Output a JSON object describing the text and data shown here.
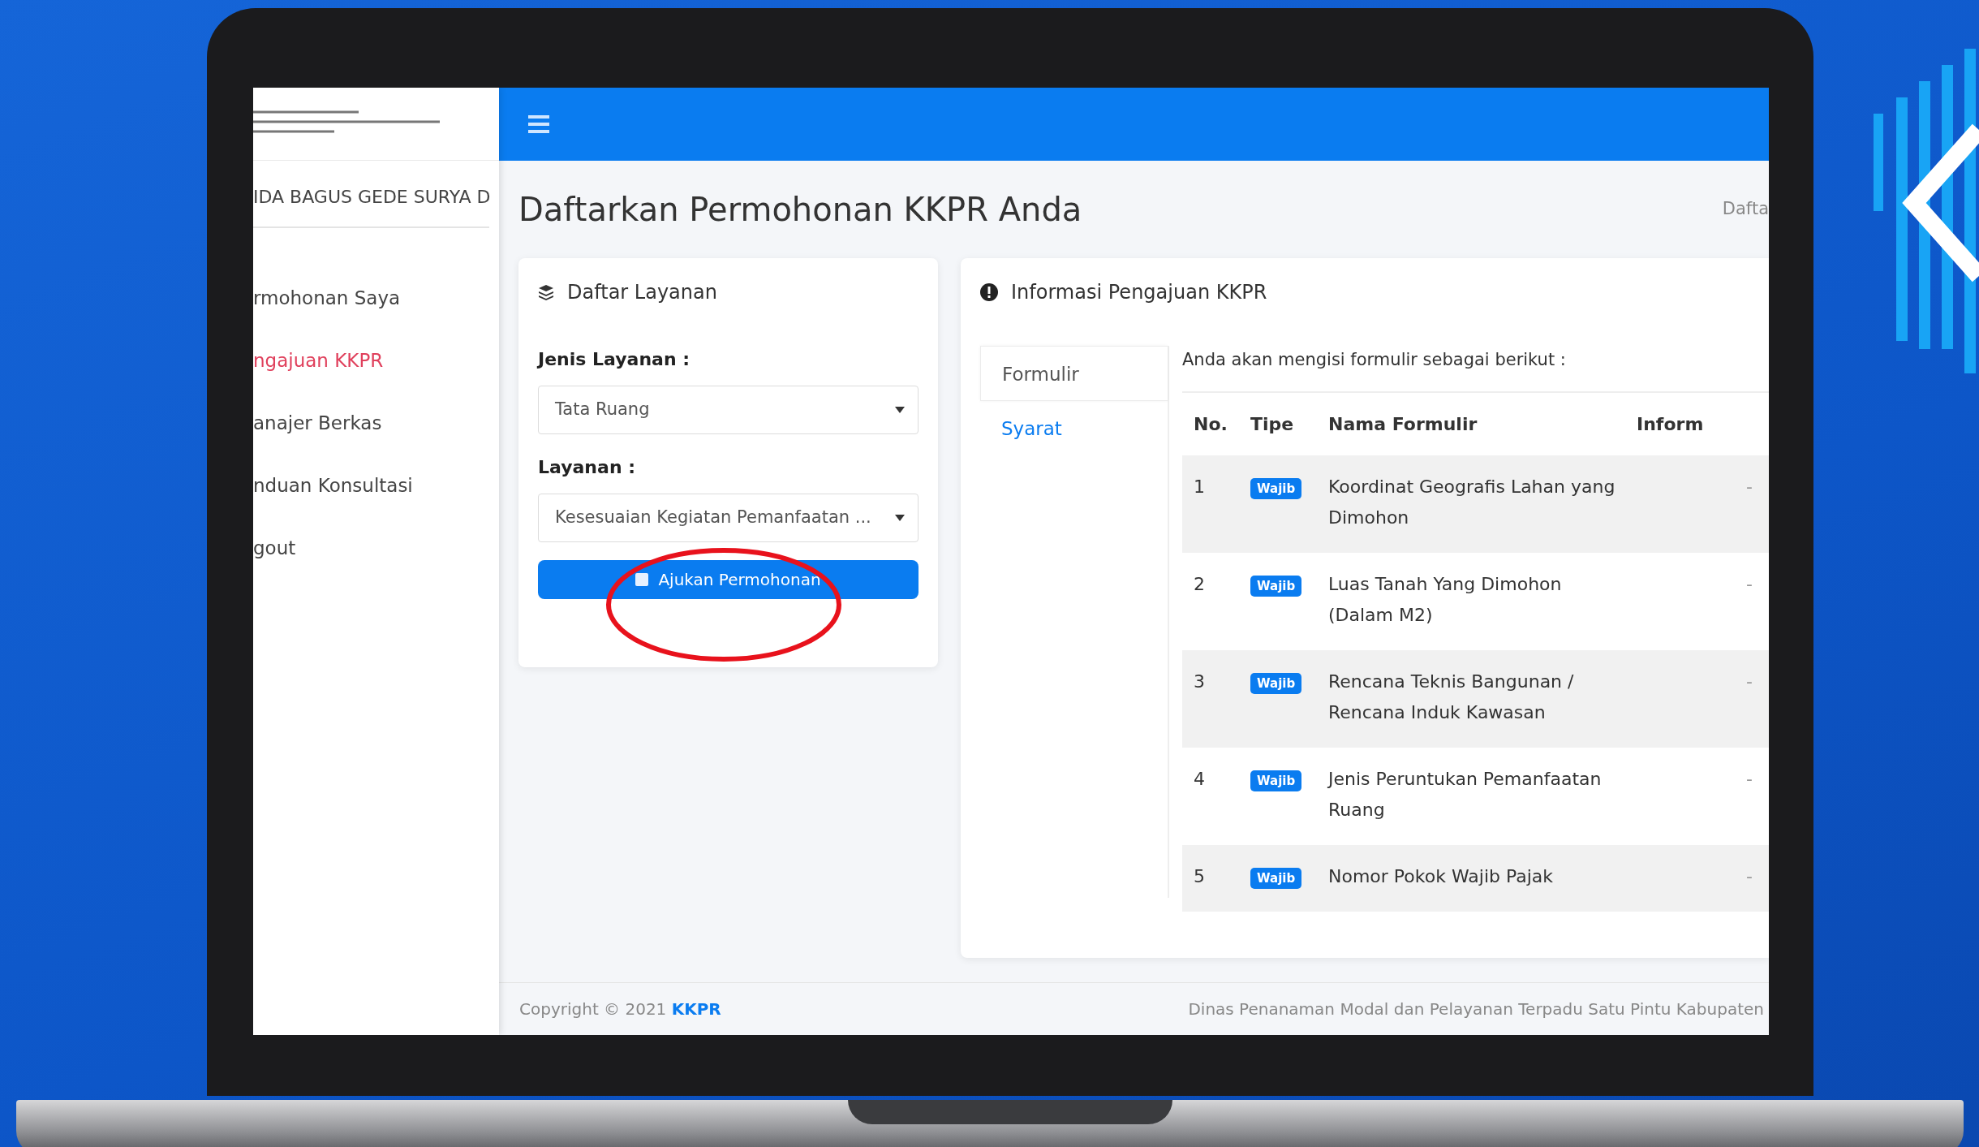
{
  "sidebar": {
    "user_name": "IDA BAGUS GEDE SURYA D",
    "items": [
      {
        "label": "rmohonan Saya",
        "selected": false
      },
      {
        "label": "ngajuan KKPR",
        "selected": true
      },
      {
        "label": "anajer Berkas",
        "selected": false
      },
      {
        "label": "nduan Konsultasi",
        "selected": false
      },
      {
        "label": "gout",
        "selected": false
      }
    ]
  },
  "page": {
    "title": "Daftarkan Permohonan KKPR Anda",
    "breadcrumb": "Dafta"
  },
  "service_card": {
    "title": "Daftar Layanan",
    "fields": [
      {
        "label": "Jenis Layanan :",
        "value": "Tata Ruang"
      },
      {
        "label": "Layanan :",
        "value": "Kesesuaian Kegiatan Pemanfaatan ..."
      }
    ],
    "button": "Ajukan Permohonan",
    "button_circled": true
  },
  "info_card": {
    "title": "Informasi Pengajuan KKPR",
    "tabs": [
      {
        "label": "Formulir",
        "selected": true
      },
      {
        "label": "Syarat",
        "selected": false
      }
    ],
    "intro": "Anda akan mengisi formulir sebagai berikut :",
    "table": {
      "columns": [
        "No.",
        "Tipe",
        "Nama Formulir",
        "Inform"
      ],
      "rows": [
        {
          "no": "1",
          "type": "Wajib",
          "name": "Koordinat Geografis Lahan yang Dimohon",
          "info": "-"
        },
        {
          "no": "2",
          "type": "Wajib",
          "name": "Luas Tanah Yang Dimohon (Dalam M2)",
          "info": "-"
        },
        {
          "no": "3",
          "type": "Wajib",
          "name": "Rencana Teknis Bangunan / Rencana Induk Kawasan",
          "info": "-"
        },
        {
          "no": "4",
          "type": "Wajib",
          "name": "Jenis Peruntukan Pemanfaatan Ruang",
          "info": "-"
        },
        {
          "no": "5",
          "type": "Wajib",
          "name": "Nomor Pokok Wajib Pajak",
          "info": "-"
        }
      ]
    }
  },
  "footer": {
    "copyright": "Copyright © 2021",
    "brand": "KKPR",
    "agency": "Dinas Penanaman Modal dan Pelayanan Terpadu Satu Pintu Kabupaten"
  }
}
